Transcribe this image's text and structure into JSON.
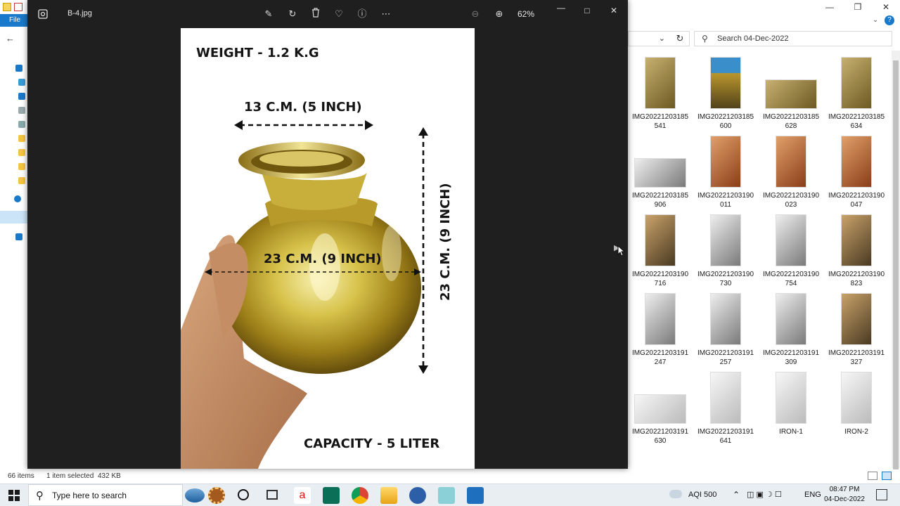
{
  "explorer": {
    "file_tab": "File",
    "search_placeholder": "Search 04-Dec-2022",
    "status": {
      "items_count": "66 items",
      "selected": "1 item selected",
      "size": "432 KB"
    },
    "files": [
      {
        "name": "IMG20221203185 541",
        "kind": "gold"
      },
      {
        "name": "IMG20221203185 600",
        "kind": "blue"
      },
      {
        "name": "IMG20221203185 628",
        "kind": "gold"
      },
      {
        "name": "IMG20221203185 634",
        "kind": "gold"
      },
      {
        "name": "IMG20221203185 906",
        "kind": "steel"
      },
      {
        "name": "IMG20221203190 011",
        "kind": "copper"
      },
      {
        "name": "IMG20221203190 023",
        "kind": "copper"
      },
      {
        "name": "IMG20221203190 047",
        "kind": "copper"
      },
      {
        "name": "IMG20221203190 716",
        "kind": "hand"
      },
      {
        "name": "IMG20221203190 730",
        "kind": "steel"
      },
      {
        "name": "IMG20221203190 754",
        "kind": "steel"
      },
      {
        "name": "IMG20221203190 823",
        "kind": "hand"
      },
      {
        "name": "IMG20221203191 247",
        "kind": "steel"
      },
      {
        "name": "IMG20221203191 257",
        "kind": "steel"
      },
      {
        "name": "IMG20221203191 309",
        "kind": "steel"
      },
      {
        "name": "IMG20221203191 327",
        "kind": "hand"
      },
      {
        "name": "IMG20221203191 630",
        "kind": "cord"
      },
      {
        "name": "IMG20221203191 641",
        "kind": "cord"
      },
      {
        "name": "IRON-1",
        "kind": "cord"
      },
      {
        "name": "IRON-2",
        "kind": "cord"
      }
    ]
  },
  "viewer": {
    "filename": "B-4.jpg",
    "zoom": "62%",
    "toolbar": [
      "edit-icon",
      "rotate-icon",
      "delete-icon",
      "favorite-icon",
      "info-icon",
      "more-icon"
    ],
    "image_text": {
      "weight": "WEIGHT - 1.2 K.G",
      "width": "13 C.M. (5 INCH)",
      "diameter": "23 C.M. (9 INCH)",
      "height": "23 C.M. (9 INCH)",
      "capacity": "CAPACITY - 5 LITER"
    }
  },
  "taskbar": {
    "search_placeholder": "Type here to search",
    "aqi": "AQI 500",
    "language": "ENG",
    "time": "08:47 PM",
    "date": "04-Dec-2022"
  },
  "colors": {
    "explorer_accent": "#1979ca",
    "viewer_bg": "#1f1f1f",
    "taskbar_bg": "#e9eef3"
  }
}
